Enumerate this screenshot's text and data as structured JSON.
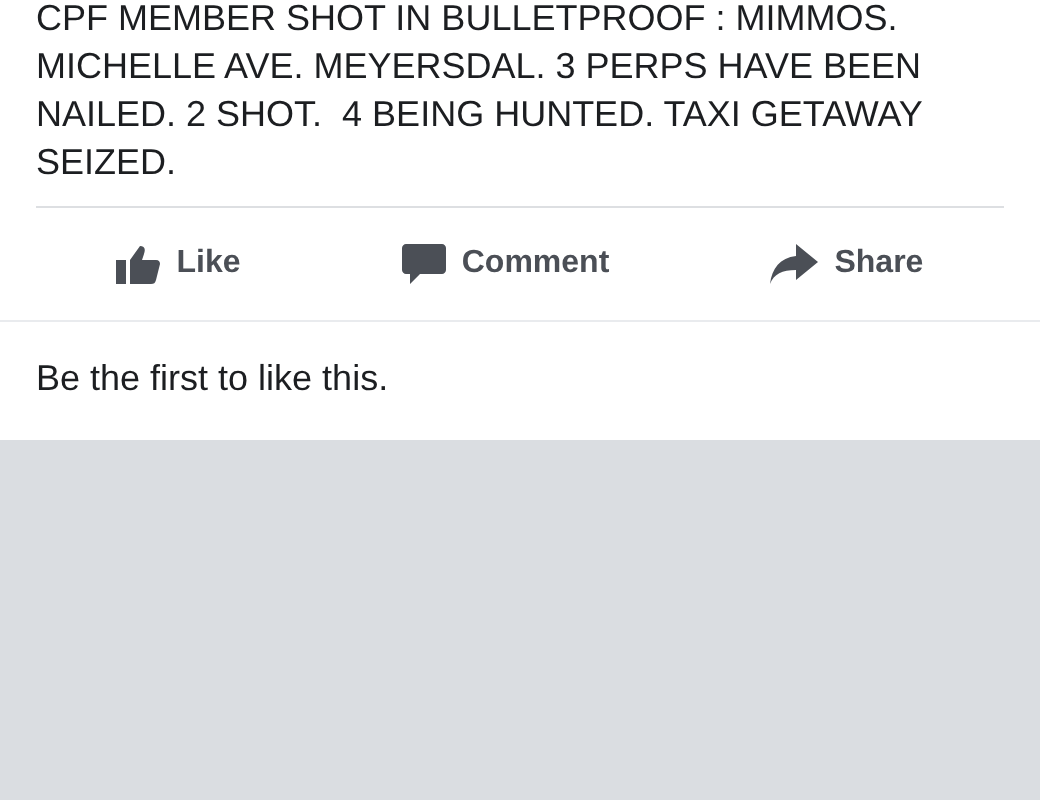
{
  "post": {
    "text": "CPF MEMBER SHOT IN BULLETPROOF : MIMMOS. MICHELLE AVE. MEYERSDAL. 3 PERPS HAVE BEEN NAILED. 2 SHOT.  4 BEING HUNTED. TAXI GETAWAY SEIZED."
  },
  "actions": [
    {
      "kind": "like",
      "label": "Like"
    },
    {
      "kind": "comment",
      "label": "Comment"
    },
    {
      "kind": "share",
      "label": "Share"
    }
  ],
  "likes_summary": "Be the first to like this."
}
